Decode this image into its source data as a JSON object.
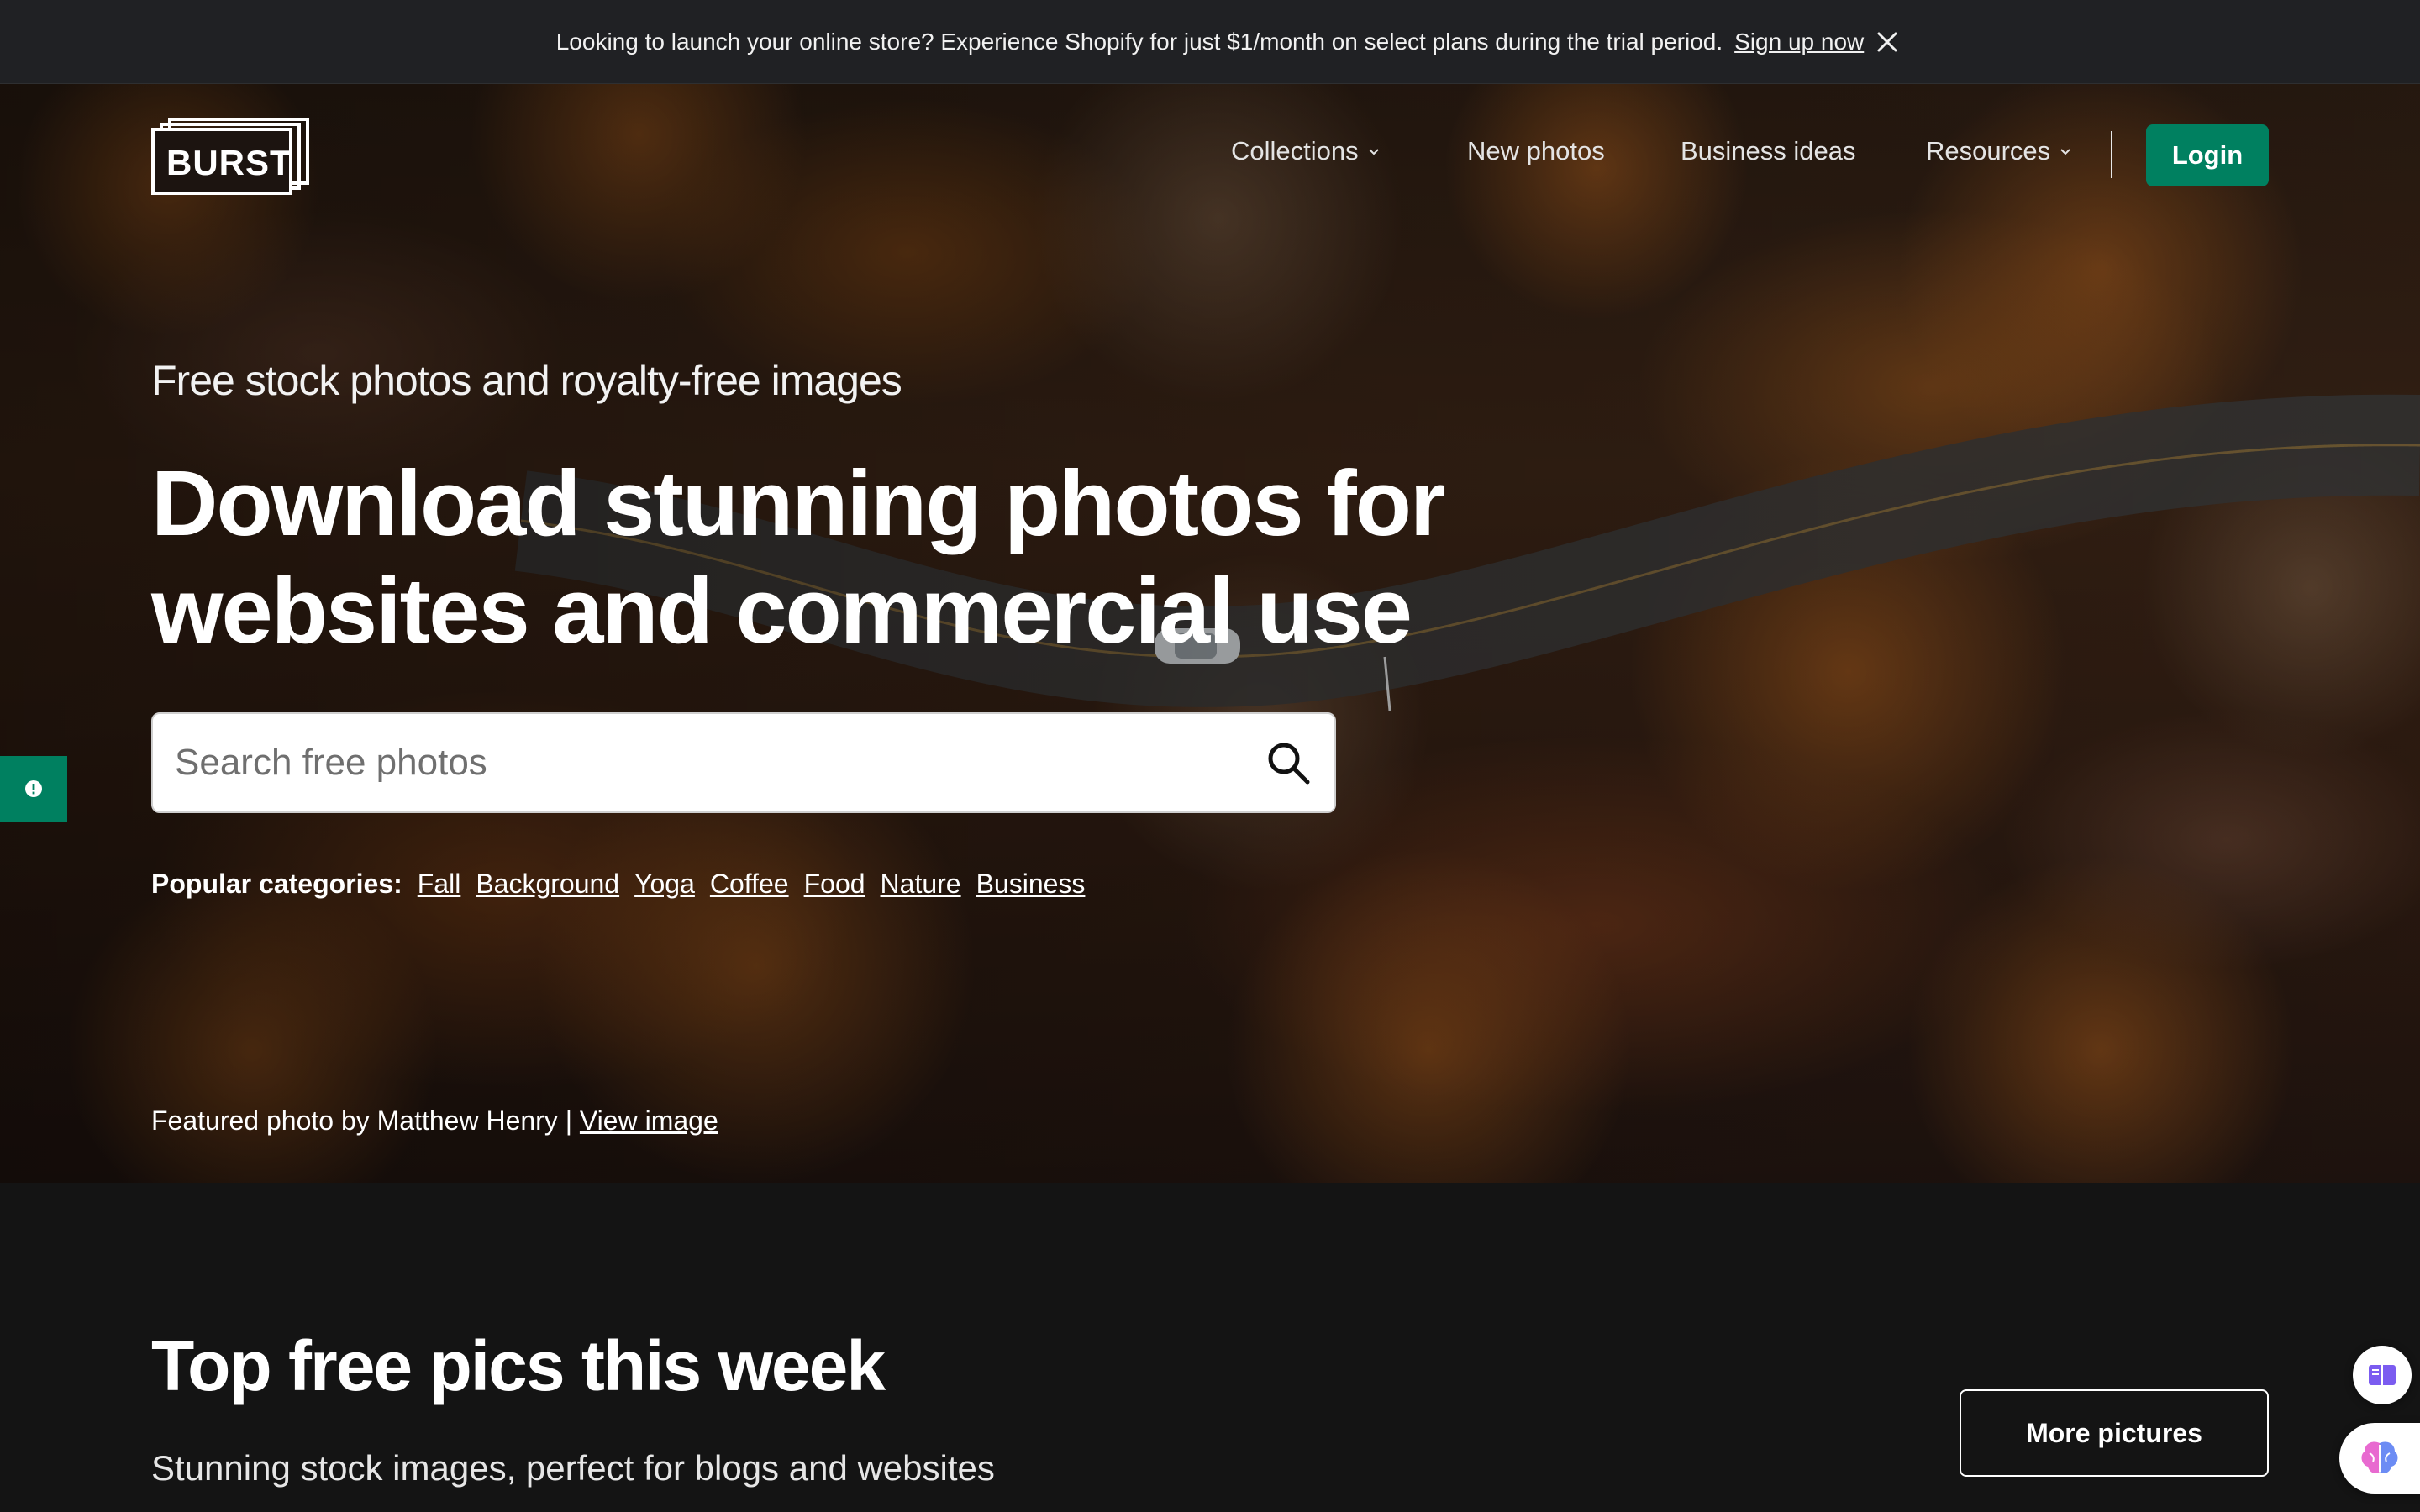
{
  "announcement": {
    "message": "Looking to launch your online store? Experience Shopify for just $1/month on select plans during the trial period.",
    "link": "Sign up now"
  },
  "header": {
    "logo_text": "BURST",
    "nav": {
      "collections": "Collections",
      "new_photos": "New photos",
      "business_ideas": "Business ideas",
      "resources": "Resources"
    },
    "login": "Login"
  },
  "hero": {
    "eyebrow": "Free stock photos and royalty-free images",
    "headline": "Download stunning photos for websites and commercial use",
    "search_placeholder": "Search free photos",
    "categories_label": "Popular categories:",
    "categories": [
      "Fall",
      "Background",
      "Yoga",
      "Coffee",
      "Food",
      "Nature",
      "Business"
    ],
    "featured_prefix": "Featured photo by Matthew Henry |",
    "featured_link": "View image"
  },
  "section": {
    "title": "Top free pics this week",
    "subtitle": "Stunning stock images, perfect for blogs and websites",
    "more_button": "More pictures"
  },
  "colors": {
    "accent": "#008060",
    "announcement_bg": "#202124",
    "page_bg": "#141414"
  },
  "icons": {
    "close": "close-icon",
    "chevron": "chevron-down-icon",
    "search": "search-icon",
    "help": "exclamation-circle-icon",
    "book": "book-icon",
    "brain": "brain-icon"
  }
}
